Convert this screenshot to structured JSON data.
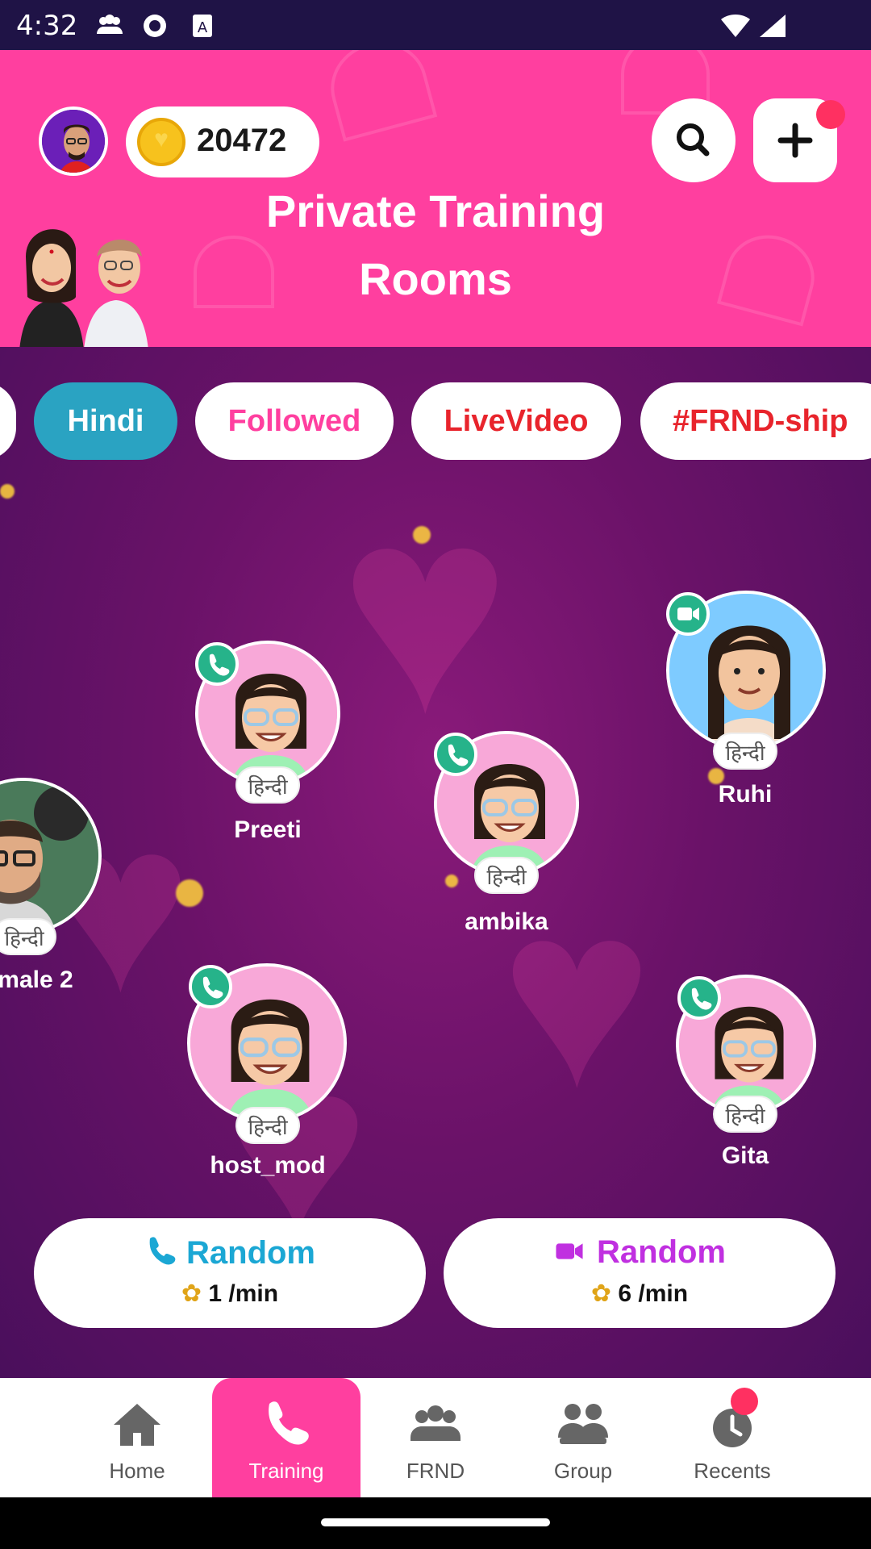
{
  "status_bar": {
    "time": "4:32"
  },
  "header": {
    "coin_count": "20472",
    "title": "Private Training Rooms"
  },
  "chips": [
    {
      "label": "Hindi",
      "color": "#ffffff",
      "active": true
    },
    {
      "label": "Followed",
      "color": "#ff3f9f",
      "active": false
    },
    {
      "label": "LiveVideo",
      "color": "#e8242c",
      "active": false
    },
    {
      "label": "#FRND-ship",
      "color": "#e8242c",
      "active": false
    }
  ],
  "users": [
    {
      "name": "Preeti",
      "lang": "हिन्दी",
      "call": "voice"
    },
    {
      "name": "ambika",
      "lang": "हिन्दी",
      "call": "voice"
    },
    {
      "name": "Ruhi",
      "lang": "हिन्दी",
      "call": "video"
    },
    {
      "name": "male 2",
      "lang": "हिन्दी",
      "call": "voice"
    },
    {
      "name": "host_mod",
      "lang": "हिन्दी",
      "call": "voice"
    },
    {
      "name": "Gita",
      "lang": "हिन्दी",
      "call": "voice"
    }
  ],
  "random_buttons": {
    "voice": {
      "label": "Random",
      "price": "1 /min",
      "color": "#1ba7d4"
    },
    "video": {
      "label": "Random",
      "price": "6 /min",
      "color": "#c030e0"
    }
  },
  "nav": [
    {
      "label": "Home",
      "icon": "home-icon",
      "active": false
    },
    {
      "label": "Training",
      "icon": "phone-icon",
      "active": true
    },
    {
      "label": "FRND",
      "icon": "friends-icon",
      "active": false
    },
    {
      "label": "Group",
      "icon": "group-icon",
      "active": false
    },
    {
      "label": "Recents",
      "icon": "clock-icon",
      "active": false
    }
  ],
  "colors": {
    "header": "#ff3f9f",
    "accent_blue": "#2aa3c2",
    "call_green": "#26b38a"
  }
}
